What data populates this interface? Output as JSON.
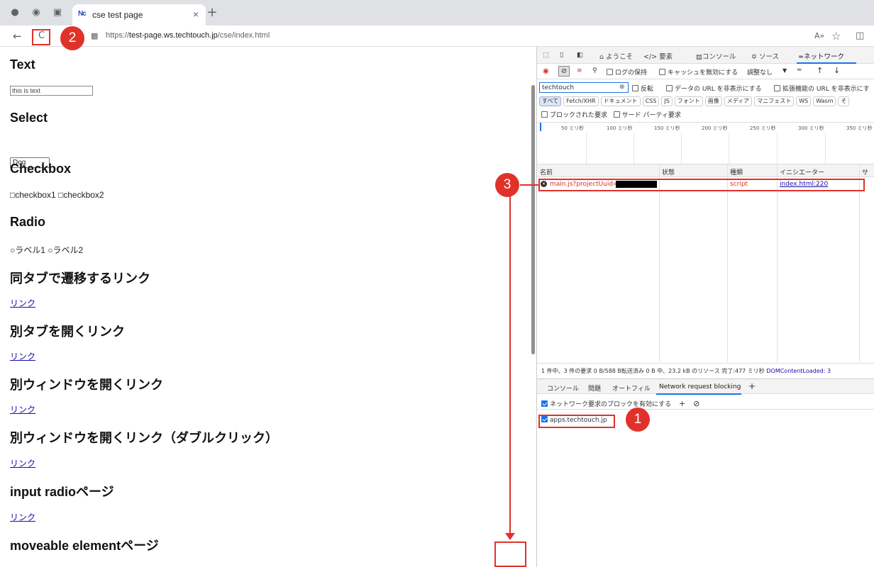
{
  "browser": {
    "tab_title": "cse test page",
    "tab_favicon": "Nc",
    "tab_close": "×",
    "new_tab": "+",
    "url_scheme": "https://",
    "url_host": "test-page.ws.techtouch.jp",
    "url_path": "/cse/index.html",
    "read_aloud": "A»",
    "back": "←",
    "reload": "C"
  },
  "page": {
    "sections": [
      {
        "heading": "Text"
      },
      {
        "heading": "Select"
      },
      {
        "heading": "Checkbox"
      },
      {
        "heading": "Radio"
      },
      {
        "heading": "同タブで遷移するリンク",
        "link": "リンク"
      },
      {
        "heading": "別タブを開くリンク",
        "link": "リンク"
      },
      {
        "heading": "別ウィンドウを開くリンク",
        "link": "リンク"
      },
      {
        "heading": "別ウィンドウを開くリンク（ダブルクリック）",
        "link": "リンク"
      },
      {
        "heading": "input radioページ",
        "link": "リンク"
      },
      {
        "heading": "moveable elementページ"
      }
    ],
    "text_input_value": "this is text",
    "select_value": "Dog",
    "checkbox_labels": [
      "checkbox1",
      "checkbox2"
    ],
    "radio_labels": [
      "ラベル1",
      "ラベル2"
    ]
  },
  "devtools": {
    "tabs": [
      "ようこそ",
      "要素",
      "コンソール",
      "ソース",
      "ネットワーク"
    ],
    "tab_icons": [
      "home-icon",
      "elements-icon",
      "console-icon",
      "bug-icon",
      "wifi-icon"
    ],
    "toolbar": {
      "preserve_log": "ログの保持",
      "disable_cache": "キャッシュを無効にする",
      "throttle": "調整なし"
    },
    "filter": {
      "value": "techtouch",
      "invert": "反転",
      "hide_data_urls": "データの URL を非表示にする",
      "hide_ext_urls": "拡張機能の URL を非表示にす"
    },
    "type_chips": [
      "すべて",
      "Fetch/XHR",
      "ドキュメント",
      "CSS",
      "JS",
      "フォント",
      "画像",
      "メディア",
      "マニフェスト",
      "WS",
      "Wasm",
      "そ"
    ],
    "blocked_requests": "ブロックされた要求",
    "third_party": "サード パーティ要求",
    "timeline_ticks": [
      "50 ミリ秒",
      "100 ミリ秒",
      "150 ミリ秒",
      "200 ミリ秒",
      "250 ミリ秒",
      "300 ミリ秒",
      "350 ミリ秒"
    ],
    "columns": [
      "名前",
      "状態",
      "種類",
      "イニシエーター",
      "サ"
    ],
    "request": {
      "name": "main.js?projectUuid=",
      "type": "script",
      "initiator": "index.html:220"
    },
    "summary": "1 件中、3 件の要求  0 B/588 B転送済み  0 B 中、23.2 kB のリソース  完了:477 ミリ秒",
    "dom_content_loaded": "DOMContentLoaded: 3",
    "drawer_tabs": [
      "コンソール",
      "問題",
      "オートフィル",
      "Network request blocking",
      "+"
    ],
    "enable_blocking": "ネットワーク要求のブロックを有効にする",
    "blocked_pattern": "apps.techtouch.jp"
  },
  "annotations": {
    "badge1": "1",
    "badge2": "2",
    "badge3": "3",
    "accent_color": "#e0322b"
  }
}
